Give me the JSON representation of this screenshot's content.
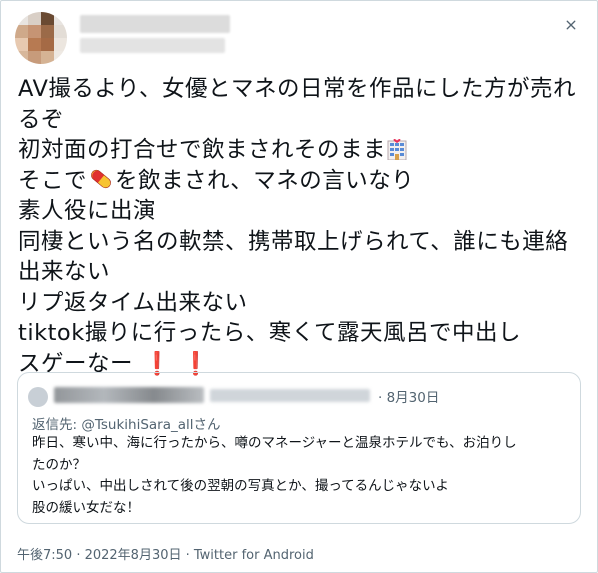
{
  "tweet": {
    "lines": [
      "AV撮るより、女優とマネの日常を作品にした方が売れ",
      "るぞ",
      "初対面の打合せで飲まされそのまま",
      "そこで",
      "を飲まされ、マネの言いなり",
      "素人役に出演",
      "同棲という名の軟禁、携帯取上げられて、誰にも連絡",
      "出来ない",
      "リプ返タイム出来ない",
      "tiktok撮りに行ったら、寒くて露天風呂で中出し",
      "スゲーなー",
      "❗",
      "❗"
    ],
    "emoji": [
      "love-hotel-emoji",
      "pill-emoji",
      "exclamation-emoji"
    ]
  },
  "quote": {
    "date": "· 8月30日",
    "reply_to": "返信先: @TsukihiSara_allさん",
    "lines": [
      "昨日、寒い中、海に行ったから、噂のマネージャーと温泉ホテルでも、お泊りし",
      "たのか？",
      "いっぱい、中出しされて後の翌朝の写真とか、撮ってるんじゃないよ",
      "股の緩い女だな！"
    ]
  },
  "footer": {
    "meta": "午後7:50 · 2022年8月30日 · Twitter for Android"
  },
  "icons": {
    "more": "more-icon"
  },
  "colors": {
    "text": "#0f1419",
    "muted": "#536471",
    "border": "#cfd9de",
    "exclaim": "#d9232e"
  }
}
